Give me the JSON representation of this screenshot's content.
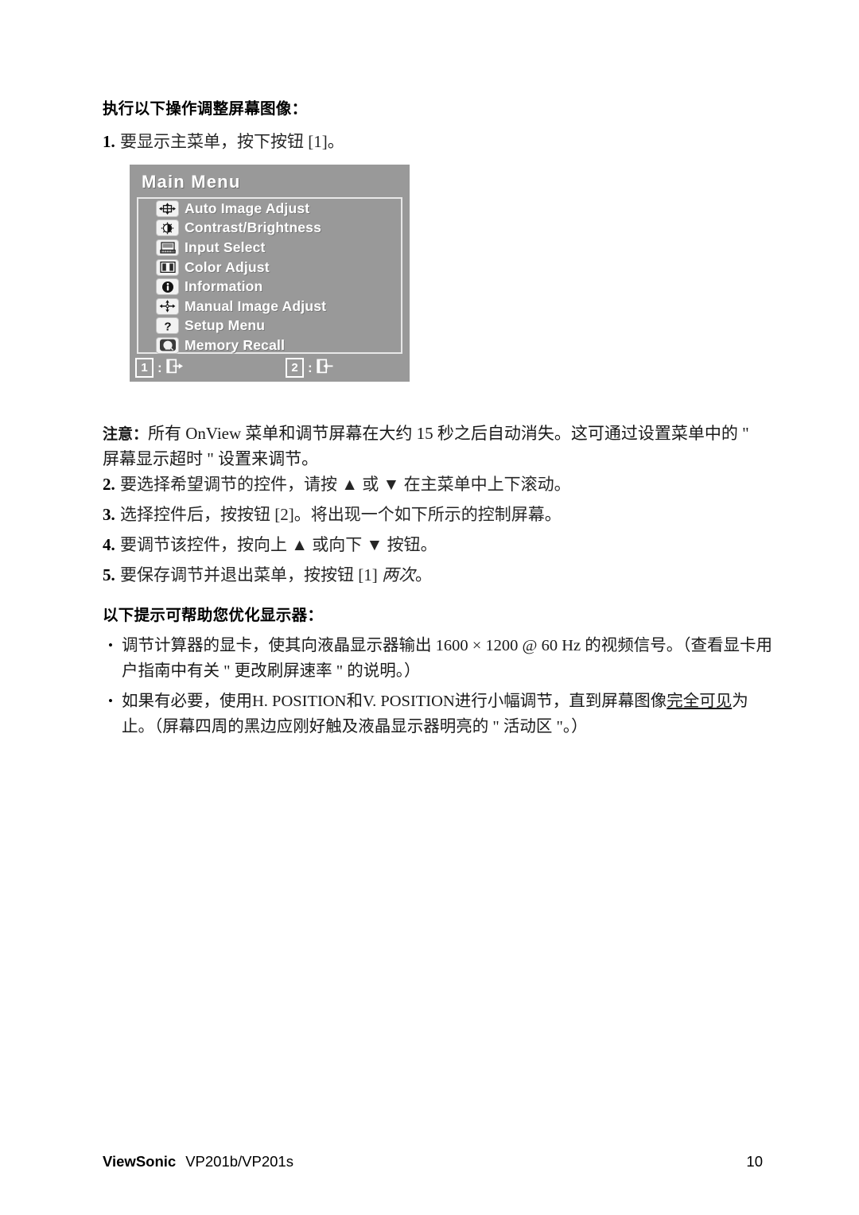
{
  "document": {
    "heading_1": "执行以下操作调整屏幕图像：",
    "heading_2": "以下提示可帮助您优化显示器：",
    "steps": [
      {
        "num": "1.",
        "text": "要显示主菜单，按下按钮 [1]。"
      },
      {
        "num": "2.",
        "text": "要选择希望调节的控件，请按 ▲ 或 ▼ 在主菜单中上下滚动。"
      },
      {
        "num": "3.",
        "text": "选择控件后，按按钮 [2]。将出现一个如下所示的控制屏幕。"
      },
      {
        "num": "4.",
        "text": "要调节该控件，按向上 ▲ 或向下 ▼ 按钮。"
      },
      {
        "num": "5.",
        "text_before": "要保存调节并退出菜单，按按钮 [1] ",
        "text_italic": "两次",
        "text_after": "。"
      }
    ],
    "note": {
      "label": "注意：",
      "text": "所有 OnView 菜单和调节屏幕在大约 15 秒之后自动消失。这可通过设置菜单中的 \" 屏幕显示超时 \" 设置来调节。"
    },
    "bullets": [
      {
        "marker": "•",
        "text": "调节计算器的显卡，使其向液晶显示器输出 1600 × 1200 @ 60 Hz 的视频信号。（查看显卡用户指南中有关 \" 更改刷屏速率 \" 的说明。）"
      },
      {
        "marker": "•",
        "text_before": "如果有必要，使用H. POSITION和V. POSITION进行小幅调节，直到屏幕图像",
        "text_underline": "完全可见",
        "text_after": "为止。（屏幕四周的黑边应刚好触及液晶显示器明亮的 \" 活动区 \"。）"
      }
    ]
  },
  "osd": {
    "title": "Main Menu",
    "background_color": "#999999",
    "text_color": "#ffffff",
    "items": [
      {
        "icon": "crosshair-arrows-icon",
        "label": "Auto Image Adjust"
      },
      {
        "icon": "contrast-brightness-icon",
        "label": "Contrast/Brightness"
      },
      {
        "icon": "monitor-input-icon",
        "label": "Input Select"
      },
      {
        "icon": "color-bars-icon",
        "label": "Color Adjust"
      },
      {
        "icon": "info-circle-icon",
        "label": "Information"
      },
      {
        "icon": "four-way-arrows-icon",
        "label": "Manual Image Adjust"
      },
      {
        "icon": "question-mark-icon",
        "label": "Setup Menu"
      },
      {
        "icon": "memory-recall-icon",
        "label": "Memory Recall"
      }
    ],
    "footer_keys": [
      {
        "key": "1",
        "separator": ":",
        "icon": "exit-door-icon"
      },
      {
        "key": "2",
        "separator": ":",
        "icon": "enter-door-icon"
      }
    ]
  },
  "footer": {
    "brand": "ViewSonic",
    "model": "VP201b/VP201s",
    "page_number": "10"
  }
}
